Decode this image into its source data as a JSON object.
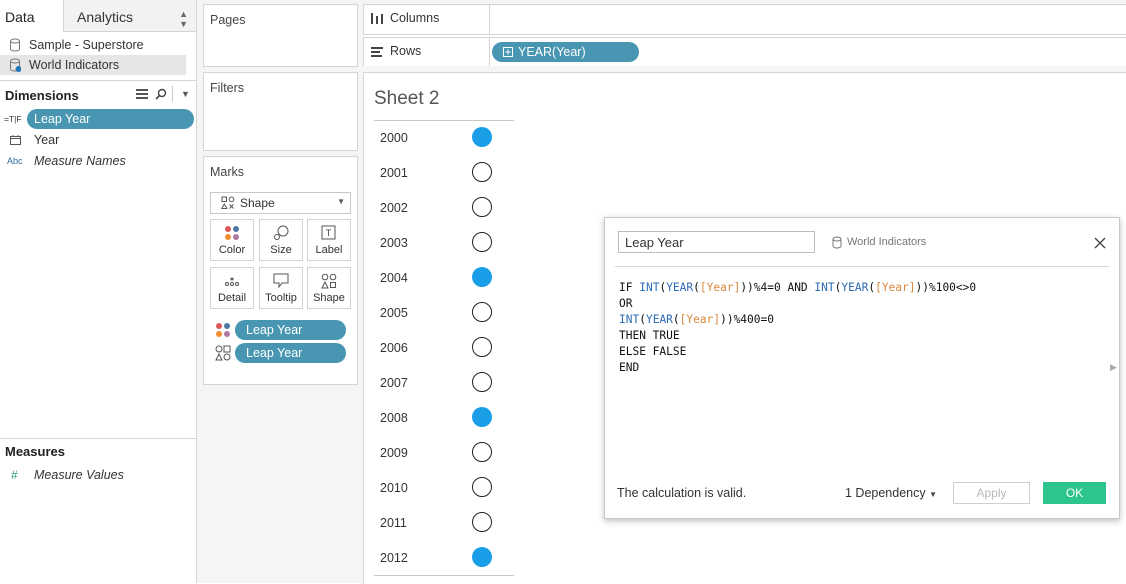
{
  "data_pane": {
    "tab_data": "Data",
    "tab_analytics": "Analytics",
    "datasources": [
      "Sample - Superstore",
      "World Indicators"
    ],
    "dimensions_header": "Dimensions",
    "dimensions": [
      {
        "type_badge": "=T|F",
        "label": "Leap Year"
      },
      {
        "label": "Year"
      },
      {
        "type_badge": "Abc",
        "label": "Measure Names"
      }
    ],
    "measures_header": "Measures",
    "measures": [
      {
        "type_badge": "#",
        "label": "Measure Values"
      }
    ]
  },
  "cards": {
    "pages_title": "Pages",
    "filters_title": "Filters",
    "marks_title": "Marks",
    "mark_type": "Shape",
    "mark_buttons": [
      "Color",
      "Size",
      "Label",
      "Detail",
      "Tooltip",
      "Shape"
    ],
    "encodings": [
      "Leap Year",
      "Leap Year"
    ]
  },
  "shelves": {
    "columns_label": "Columns",
    "rows_label": "Rows",
    "rows_pill": "YEAR(Year)"
  },
  "sheet": {
    "title": "Sheet 2",
    "rows": [
      {
        "year": "2000",
        "leap": true
      },
      {
        "year": "2001",
        "leap": false
      },
      {
        "year": "2002",
        "leap": false
      },
      {
        "year": "2003",
        "leap": false
      },
      {
        "year": "2004",
        "leap": true
      },
      {
        "year": "2005",
        "leap": false
      },
      {
        "year": "2006",
        "leap": false
      },
      {
        "year": "2007",
        "leap": false
      },
      {
        "year": "2008",
        "leap": true
      },
      {
        "year": "2009",
        "leap": false
      },
      {
        "year": "2010",
        "leap": false
      },
      {
        "year": "2011",
        "leap": false
      },
      {
        "year": "2012",
        "leap": true
      }
    ],
    "colors": {
      "true": "#1a9ee8",
      "false": "#ffffff"
    }
  },
  "calc_dialog": {
    "name": "Leap Year",
    "datasource": "World Indicators",
    "status": "The calculation is valid.",
    "dependency": "1 Dependency",
    "apply_label": "Apply",
    "ok_label": "OK",
    "formula_lines": [
      "IF INT(YEAR([Year]))%4=0 AND INT(YEAR([Year]))%100<>0",
      "OR",
      "INT(YEAR([Year]))%400=0",
      "THEN TRUE",
      "ELSE FALSE",
      "END"
    ]
  },
  "theme": {
    "pill": "#4996b2",
    "ok_button": "#2cc58e"
  }
}
